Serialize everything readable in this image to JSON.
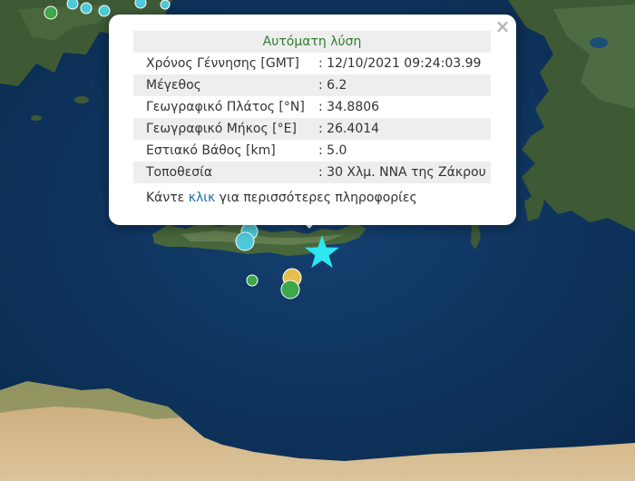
{
  "popup": {
    "title": "Αυτόματη λύση",
    "close_symbol": "×",
    "rows": [
      {
        "label": "Χρόνος Γέννησης [GMT]",
        "value": ": 12/10/2021 09:24:03.99"
      },
      {
        "label": "Μέγεθος",
        "value": ": 6.2"
      },
      {
        "label": "Γεωγραφικό Πλάτος [°N]",
        "value": ": 34.8806"
      },
      {
        "label": "Γεωγραφικό Μήκος [°E]",
        "value": ": 26.4014"
      },
      {
        "label": "Εστιακό Βάθος [km]",
        "value": ": 5.0"
      },
      {
        "label": "Τοποθεσία",
        "value": ": 30 Χλμ. ΝΝΑ της Ζάκρου"
      }
    ],
    "more_prefix": "Κάντε ",
    "more_link": "κλικ",
    "more_suffix": " για περισσότερες πληροφορίες"
  },
  "colors": {
    "sea": "#0d3158",
    "land": "#3e5a35",
    "desert": "#d3b68a",
    "epicenter": "#2ee6f0",
    "quake_green": "#3fa64a",
    "quake_yellow": "#e3c04e",
    "quake_cyan": "#4ec9d9",
    "popup_title": "#2f7d2f",
    "link": "#1a6fa8"
  },
  "icons": {
    "epicenter": "star-icon",
    "events": "circle-icon",
    "close": "close-icon"
  }
}
